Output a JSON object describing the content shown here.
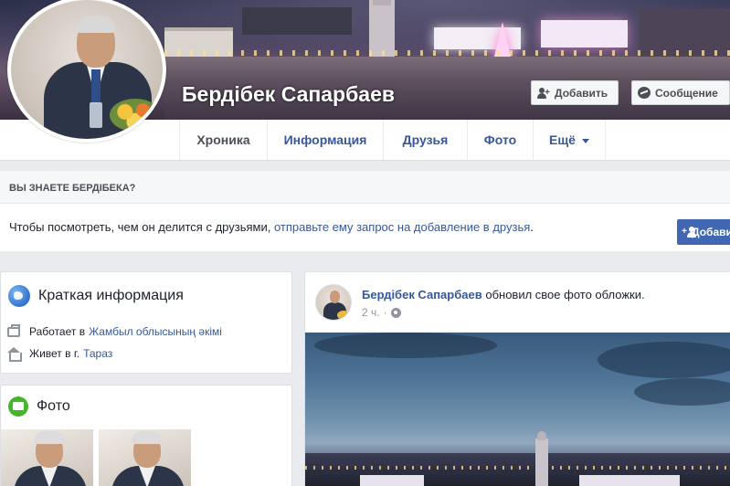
{
  "profile": {
    "name": "Бердібек Сапарбаев",
    "add_friend_label": "Добавить",
    "message_label": "Сообщение"
  },
  "tabs": [
    {
      "label": "Хроника",
      "active": true
    },
    {
      "label": "Информация",
      "active": false
    },
    {
      "label": "Друзья",
      "active": false
    },
    {
      "label": "Фото",
      "active": false
    },
    {
      "label": "Ещё",
      "active": false
    }
  ],
  "friend_prompt": {
    "header": "ВЫ ЗНАЕТЕ БЕРДІБЕКА?",
    "text": "Чтобы посмотреть, чем он делится с друзьями,",
    "link": "отправьте ему запрос на добавление в друзья",
    "text_end": ".",
    "button_label": "Добавить"
  },
  "intro": {
    "title": "Краткая информация",
    "work_prefix": "Работает в",
    "work_link": "Жамбыл облысының әкімі",
    "lives_prefix": "Живет в г.",
    "lives_link": "Тараз"
  },
  "photos": {
    "title": "Фото"
  },
  "post": {
    "author": "Бердібек Сапарбаев",
    "action": "обновил свое фото обложки.",
    "time": "2 ч.",
    "separator": "·"
  },
  "colors": {
    "link": "#365899",
    "primary_button": "#4267b2",
    "page_background": "#e9ebee",
    "success_green": "#42b72a"
  },
  "icons": {
    "add_friend": "add-friend-icon",
    "message": "messenger-icon",
    "intro": "globe-icon",
    "work": "briefcase-icon",
    "home": "house-icon",
    "photos": "photo-icon",
    "audience": "public-globe-icon",
    "dropdown": "caret-down-icon"
  }
}
